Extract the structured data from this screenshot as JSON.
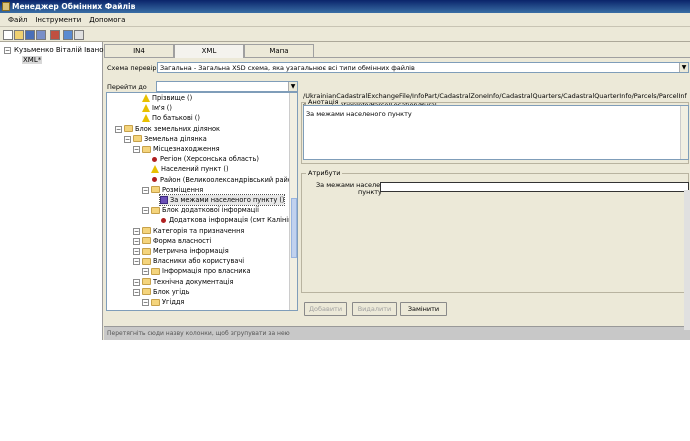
{
  "window": {
    "title": "Менеджер Обмінних Файлів"
  },
  "menu": {
    "items": [
      "Файл",
      "Інструменти",
      "Допомога"
    ]
  },
  "toolbar": {
    "icons": [
      "new-icon",
      "open-icon",
      "save-icon",
      "save-all-icon",
      "print-icon",
      "validate-icon",
      "check-icon"
    ]
  },
  "left_tree": {
    "root": "Кузьменко Віталій Іванович",
    "child": "XML*"
  },
  "tabs": [
    {
      "label": "IN4",
      "active": false
    },
    {
      "label": "XML",
      "active": true
    },
    {
      "label": "Мапа",
      "active": false
    }
  ],
  "schema": {
    "label": "Схема перевірки",
    "value": "Загальна - Загальна XSD схема, яка узагальнює всі типи обмінних файлів"
  },
  "goto": {
    "label": "Перейти до",
    "value": ""
  },
  "tree": [
    {
      "text": "Прізвище ()",
      "icon": "warning-icon",
      "level": 3
    },
    {
      "text": "Ім'я ()",
      "icon": "warning-icon",
      "level": 3
    },
    {
      "text": "По батькові ()",
      "icon": "warning-icon",
      "level": 3
    },
    {
      "text": "Блок земельних ділянок",
      "icon": "folder-icon",
      "level": 1
    },
    {
      "text": "Земельна ділянка",
      "icon": "folder-icon",
      "level": 2
    },
    {
      "text": "Місцезнаходження",
      "icon": "folder-icon",
      "level": 3
    },
    {
      "text": "Регіон (Херсонська область)",
      "icon": "dot-icon",
      "level": 4
    },
    {
      "text": "Населений пункт ()",
      "icon": "warning-icon",
      "level": 4
    },
    {
      "text": "Район (Великоолександрівський район)",
      "icon": "dot-icon",
      "level": 4
    },
    {
      "text": "Розміщення",
      "icon": "folder-icon",
      "level": 4
    },
    {
      "text": "За межами населеного пункту ()",
      "icon": "puzzle-icon",
      "level": 5,
      "selected": true
    },
    {
      "text": "Блок додаткової інформації",
      "icon": "folder-icon",
      "level": 4
    },
    {
      "text": "Додаткова інформація (смт Калінінське)",
      "icon": "dot-icon",
      "level": 5
    },
    {
      "text": "Категорія та призначення",
      "icon": "folder-icon",
      "level": 3
    },
    {
      "text": "Форма власності",
      "icon": "folder-icon",
      "level": 3
    },
    {
      "text": "Метрична інформація",
      "icon": "folder-icon",
      "level": 3
    },
    {
      "text": "Власники або користувачі",
      "icon": "folder-icon",
      "level": 3
    },
    {
      "text": "Інформація про власника",
      "icon": "folder-icon",
      "level": 4
    },
    {
      "text": "Технічна документація",
      "icon": "folder-icon",
      "level": 3
    },
    {
      "text": "Блок угідь",
      "icon": "folder-icon",
      "level": 3
    },
    {
      "text": "Угіддя",
      "icon": "folder-icon",
      "level": 4
    }
  ],
  "path": "/UkrainianCadastralExchangeFile/InfoPart/CadastralZoneInfo/CadastralQuarters/CadastralQuarterInfo/Parcels/ParcelInfo/ParcelLocationInfo/ParcelLocation/Rural",
  "annotation": {
    "title": "Анотація",
    "text": "За межами населеного пункту"
  },
  "attributes": {
    "title": "Атрибути",
    "field_label_1": "За межами населеного",
    "field_label_2": "пункту",
    "field_value": ""
  },
  "buttons": {
    "add": "Добавити",
    "delete": "Видалити",
    "replace": "Замінити"
  },
  "group_hint": "Перетягніть сюди назву колонки, щоб згрупувати за нею"
}
